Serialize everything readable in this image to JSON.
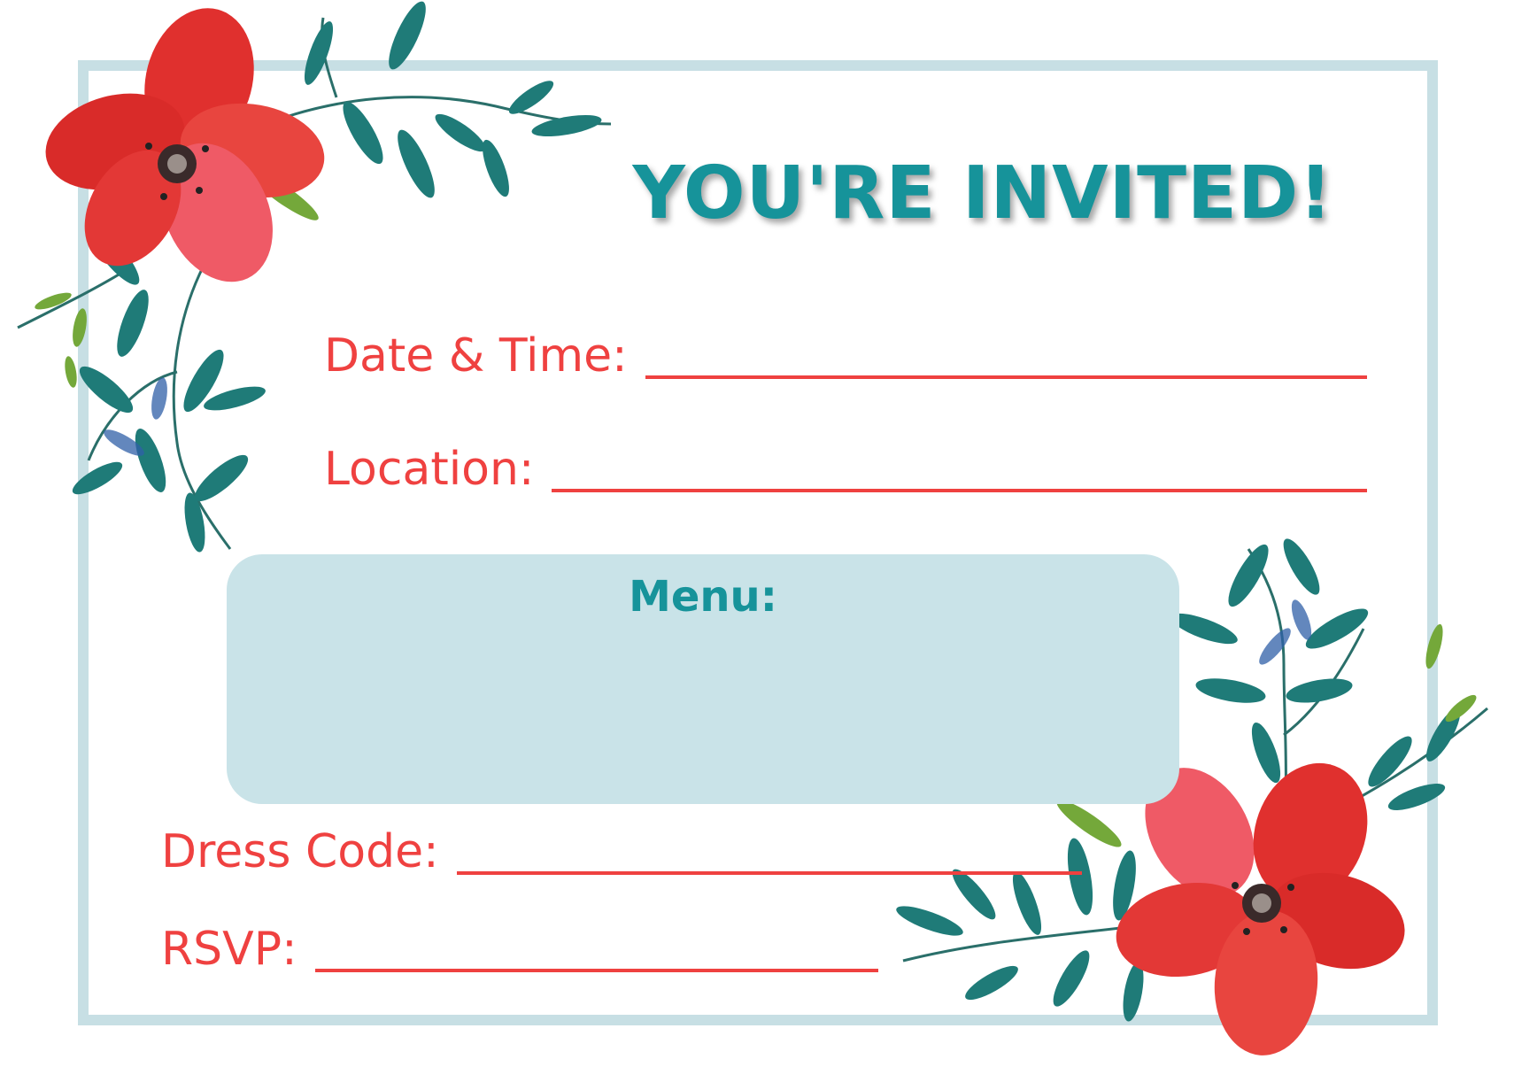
{
  "invitation": {
    "title": "YOU'RE INVITED!",
    "fields": {
      "date_time": "Date & Time:",
      "location": "Location:",
      "dress_code": "Dress Code:",
      "rsvp": "RSVP:"
    },
    "menu": {
      "title": "Menu:"
    }
  },
  "colors": {
    "frame": "#c7dfe4",
    "title": "#16939a",
    "label_and_lines": "#ef4140",
    "menu_box": "#c9e3e8",
    "flower": "#e0302e",
    "leaves": "#1f7b78"
  },
  "decorations": {
    "top_left": "red-flower-with-leaves",
    "bottom_right": "red-flower-with-leaves"
  }
}
